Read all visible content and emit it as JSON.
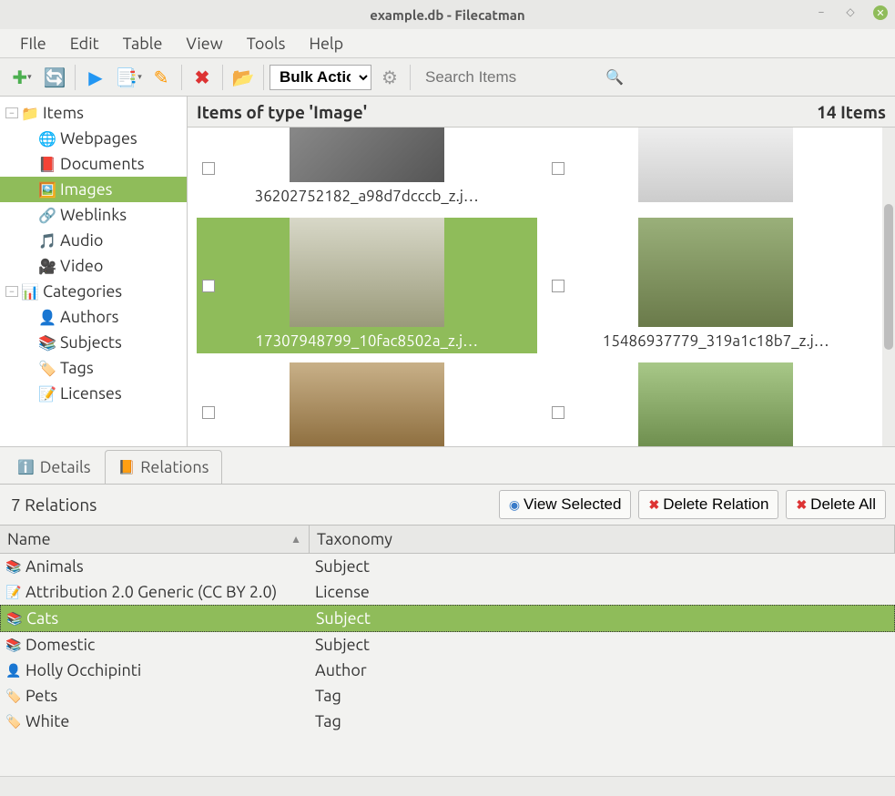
{
  "window": {
    "title": "example.db - Filecatman"
  },
  "menus": [
    "FIle",
    "Edit",
    "Table",
    "View",
    "Tools",
    "Help"
  ],
  "toolbar": {
    "bulk_label": "Bulk Action",
    "search_placeholder": "Search Items"
  },
  "sidebar": {
    "items": [
      {
        "exp": "−",
        "icon": "📁",
        "label": "Items",
        "indent": 0
      },
      {
        "icon": "🌐",
        "label": "Webpages",
        "indent": 1
      },
      {
        "icon": "📕",
        "label": "Documents",
        "indent": 1
      },
      {
        "icon": "🖼️",
        "label": "Images",
        "indent": 1,
        "selected": true
      },
      {
        "icon": "🔗",
        "label": "Weblinks",
        "indent": 1
      },
      {
        "icon": "🎵",
        "label": "Audio",
        "indent": 1
      },
      {
        "icon": "🎥",
        "label": "Video",
        "indent": 1
      },
      {
        "exp": "−",
        "icon": "📊",
        "label": "Categories",
        "indent": 0
      },
      {
        "icon": "👤",
        "label": "Authors",
        "indent": 1
      },
      {
        "icon": "📚",
        "label": "Subjects",
        "indent": 1
      },
      {
        "icon": "🏷️",
        "label": "Tags",
        "indent": 1
      },
      {
        "icon": "📝",
        "label": "Licenses",
        "indent": 1
      }
    ]
  },
  "content": {
    "heading": "Items of type 'Image'",
    "count_label": "14 Items",
    "items": [
      {
        "label": "36202752182_a98d7dcccb_z.j…",
        "cut": true
      },
      {
        "label": "",
        "cut": true
      },
      {
        "label": "17307948799_10fac8502a_z.j…",
        "selected": true
      },
      {
        "label": "15486937779_319a1c18b7_z.j…"
      },
      {
        "label": "",
        "cut": false
      },
      {
        "label": "",
        "cut": false
      }
    ]
  },
  "bottom": {
    "tabs": [
      {
        "label": "Details",
        "icon": "ℹ️"
      },
      {
        "label": "Relations",
        "icon": "📙",
        "active": true
      }
    ],
    "rel_count": "7 Relations",
    "actions": {
      "view": "View Selected",
      "del_rel": "Delete Relation",
      "del_all": "Delete All"
    },
    "headers": {
      "name": "Name",
      "tax": "Taxonomy"
    },
    "rows": [
      {
        "icon": "📚",
        "name": "Animals",
        "tax": "Subject"
      },
      {
        "icon": "📝",
        "name": "Attribution 2.0 Generic (CC BY 2.0)",
        "tax": "License"
      },
      {
        "icon": "📚",
        "name": "Cats",
        "tax": "Subject",
        "selected": true
      },
      {
        "icon": "📚",
        "name": "Domestic",
        "tax": "Subject"
      },
      {
        "icon": "👤",
        "name": "Holly Occhipinti",
        "tax": "Author"
      },
      {
        "icon": "🏷️",
        "name": "Pets",
        "tax": "Tag"
      },
      {
        "icon": "🏷️",
        "name": "White",
        "tax": "Tag"
      }
    ]
  }
}
